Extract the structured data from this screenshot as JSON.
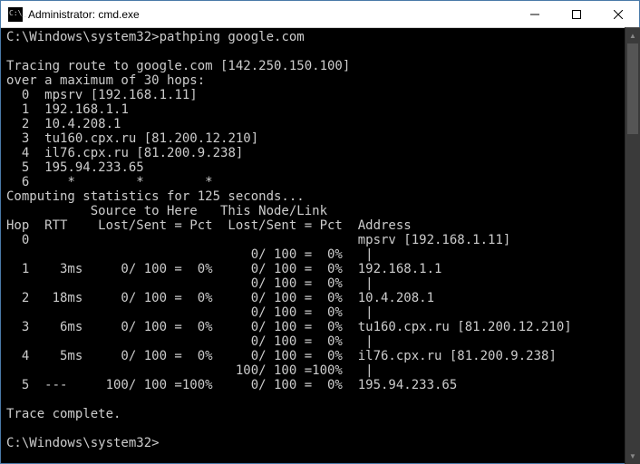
{
  "window": {
    "title": "Administrator: cmd.exe"
  },
  "terminal": {
    "prompt": "C:\\Windows\\system32>",
    "command": "pathping google.com",
    "trace_header_1": "Tracing route to google.com [142.250.150.100]",
    "trace_header_2": "over a maximum of 30 hops:",
    "route": [
      {
        "hop": 0,
        "text": "mpsrv [192.168.1.11]"
      },
      {
        "hop": 1,
        "text": "192.168.1.1"
      },
      {
        "hop": 2,
        "text": "10.4.208.1"
      },
      {
        "hop": 3,
        "text": "tu160.cpx.ru [81.200.12.210]"
      },
      {
        "hop": 4,
        "text": "il76.cpx.ru [81.200.9.238]"
      },
      {
        "hop": 5,
        "text": "195.94.233.65"
      },
      {
        "hop": 6,
        "text": "     *        *        *"
      }
    ],
    "computing": "Computing statistics for 125 seconds...",
    "stats_header_1": "           Source to Here   This Node/Link",
    "stats_header_2": "Hop  RTT    Lost/Sent = Pct  Lost/Sent = Pct  Address",
    "stats_lines": [
      "  0                                           mpsrv [192.168.1.11]",
      "                                0/ 100 =  0%   |",
      "  1    3ms     0/ 100 =  0%     0/ 100 =  0%  192.168.1.1",
      "                                0/ 100 =  0%   |",
      "  2   18ms     0/ 100 =  0%     0/ 100 =  0%  10.4.208.1",
      "                                0/ 100 =  0%   |",
      "  3    6ms     0/ 100 =  0%     0/ 100 =  0%  tu160.cpx.ru [81.200.12.210]",
      "                                0/ 100 =  0%   |",
      "  4    5ms     0/ 100 =  0%     0/ 100 =  0%  il76.cpx.ru [81.200.9.238]",
      "                              100/ 100 =100%   |",
      "  5  ---     100/ 100 =100%     0/ 100 =  0%  195.94.233.65"
    ],
    "trace_complete": "Trace complete.",
    "prompt2": "C:\\Windows\\system32>"
  }
}
